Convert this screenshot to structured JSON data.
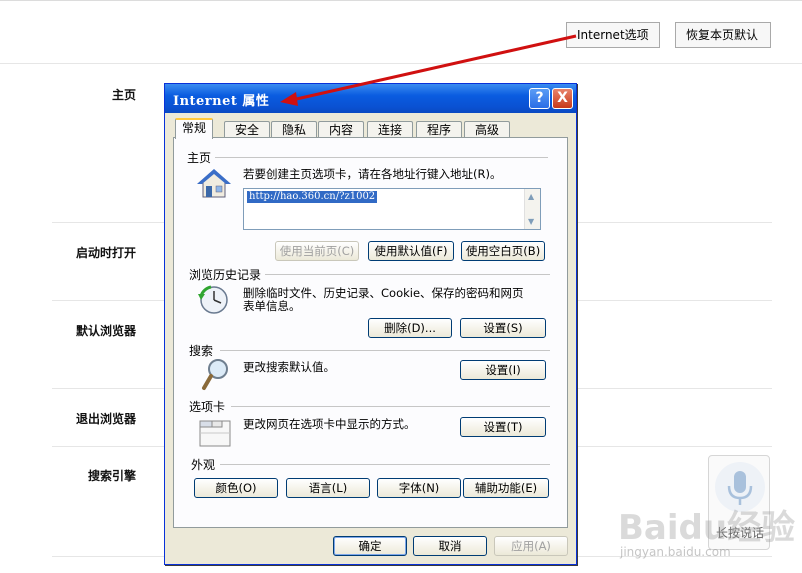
{
  "top_bar": {
    "internet_options_label": "Internet选项",
    "restore_default_label": "恢复本页默认"
  },
  "sidebar": {
    "items": [
      {
        "label": "主页"
      },
      {
        "label": "启动时打开"
      },
      {
        "label": "默认浏览器"
      },
      {
        "label": "退出浏览器"
      },
      {
        "label": "搜索引擎"
      }
    ]
  },
  "dialog": {
    "title": "Internet 属性",
    "help_glyph": "?",
    "close_glyph": "X",
    "tabs": [
      {
        "label": "常规",
        "active": true
      },
      {
        "label": "安全"
      },
      {
        "label": "隐私"
      },
      {
        "label": "内容"
      },
      {
        "label": "连接"
      },
      {
        "label": "程序"
      },
      {
        "label": "高级"
      }
    ],
    "home": {
      "title": "主页",
      "description": "若要创建主页选项卡，请在各地址行键入地址(R)。",
      "url_value": "http://hao.360.cn/?z1002",
      "use_current_label": "使用当前页(C)",
      "use_default_label": "使用默认值(F)",
      "use_blank_label": "使用空白页(B)"
    },
    "history": {
      "title": "浏览历史记录",
      "description_line1": "删除临时文件、历史记录、Cookie、保存的密码和网页",
      "description_line2": "表单信息。",
      "delete_label": "删除(D)...",
      "settings_label": "设置(S)"
    },
    "search": {
      "title": "搜索",
      "description": "更改搜索默认值。",
      "settings_label": "设置(I)"
    },
    "tabs_section": {
      "title": "选项卡",
      "description": "更改网页在选项卡中显示的方式。",
      "settings_label": "设置(T)"
    },
    "appearance": {
      "title": "外观",
      "colors_label": "颜色(O)",
      "languages_label": "语言(L)",
      "fonts_label": "字体(N)",
      "accessibility_label": "辅助功能(E)"
    },
    "footer": {
      "ok_label": "确定",
      "cancel_label": "取消",
      "apply_label": "应用(A)"
    }
  },
  "voice_widget": {
    "label": "长按说话"
  },
  "watermark": {
    "brand": "Baidu经验",
    "url": "jingyan.baidu.com"
  },
  "colors": {
    "titlebar": "#0a5ce0",
    "dialog_bg": "#ece9d8",
    "annotation_arrow": "#d01010",
    "selection": "#316ac5"
  }
}
